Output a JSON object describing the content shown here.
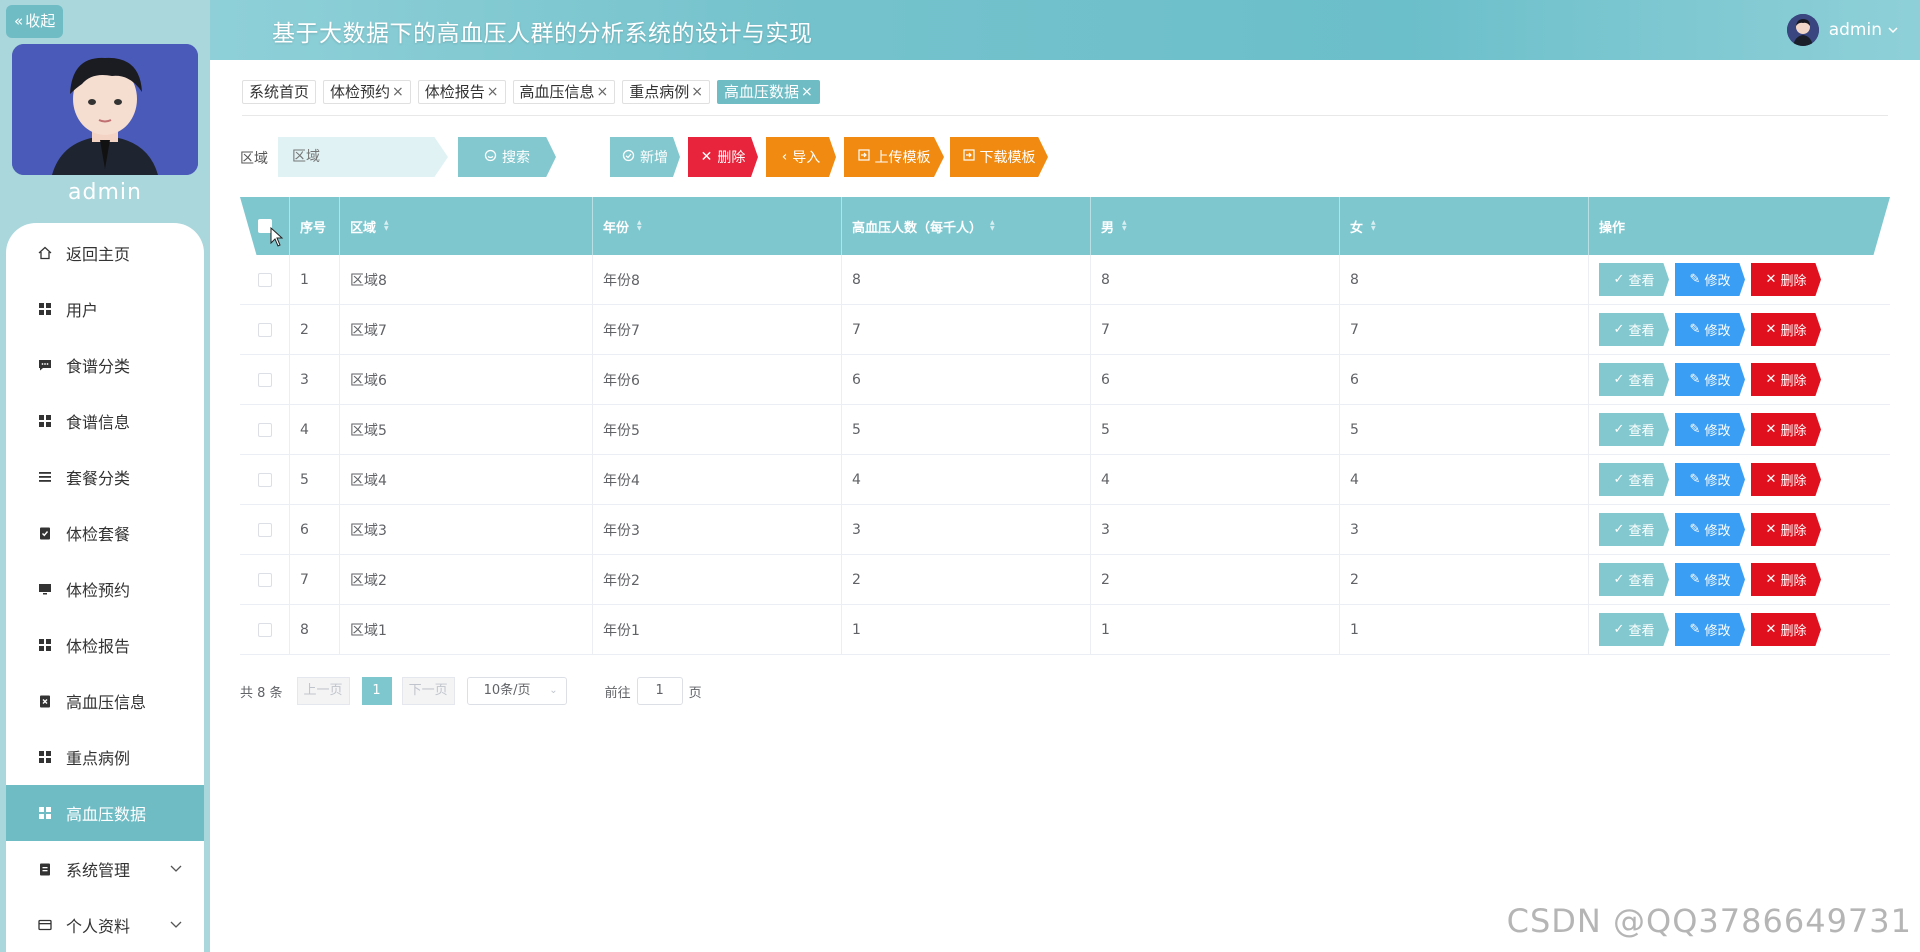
{
  "app": {
    "title": "基于大数据下的高血压人群的分析系统的设计与实现",
    "user": "admin"
  },
  "sidebar": {
    "collapse_label": "收起",
    "username": "admin",
    "items": [
      {
        "label": "返回主页",
        "icon": "home-icon"
      },
      {
        "label": "用户",
        "icon": "grid-icon"
      },
      {
        "label": "食谱分类",
        "icon": "message-icon"
      },
      {
        "label": "食谱信息",
        "icon": "grid-icon"
      },
      {
        "label": "套餐分类",
        "icon": "list-icon"
      },
      {
        "label": "体检套餐",
        "icon": "clipboard-check-icon"
      },
      {
        "label": "体检预约",
        "icon": "monitor-icon"
      },
      {
        "label": "体检报告",
        "icon": "grid-icon"
      },
      {
        "label": "高血压信息",
        "icon": "clipboard-x-icon"
      },
      {
        "label": "重点病例",
        "icon": "grid-icon"
      },
      {
        "label": "高血压数据",
        "icon": "grid-icon"
      },
      {
        "label": "系统管理",
        "icon": "clipboard-icon"
      },
      {
        "label": "个人资料",
        "icon": "card-icon"
      }
    ]
  },
  "tabs": [
    {
      "label": "系统首页",
      "closable": false
    },
    {
      "label": "体检预约",
      "closable": true
    },
    {
      "label": "体检报告",
      "closable": true
    },
    {
      "label": "高血压信息",
      "closable": true
    },
    {
      "label": "重点病例",
      "closable": true
    },
    {
      "label": "高血压数据",
      "closable": true
    }
  ],
  "search": {
    "label": "区域",
    "placeholder": "区域",
    "search_btn": "搜索"
  },
  "toolbar": {
    "add": "新增",
    "delete": "删除",
    "import": "导入",
    "upload_template": "上传模板",
    "download_template": "下载模板"
  },
  "table": {
    "headers": [
      "序号",
      "区域",
      "年份",
      "高血压人数（每千人）",
      "男",
      "女",
      "操作"
    ],
    "rows": [
      {
        "no": "1",
        "region": "区域8",
        "year": "年份8",
        "count": "8",
        "male": "8",
        "female": "8"
      },
      {
        "no": "2",
        "region": "区域7",
        "year": "年份7",
        "count": "7",
        "male": "7",
        "female": "7"
      },
      {
        "no": "3",
        "region": "区域6",
        "year": "年份6",
        "count": "6",
        "male": "6",
        "female": "6"
      },
      {
        "no": "4",
        "region": "区域5",
        "year": "年份5",
        "count": "5",
        "male": "5",
        "female": "5"
      },
      {
        "no": "5",
        "region": "区域4",
        "year": "年份4",
        "count": "4",
        "male": "4",
        "female": "4"
      },
      {
        "no": "6",
        "region": "区域3",
        "year": "年份3",
        "count": "3",
        "male": "3",
        "female": "3"
      },
      {
        "no": "7",
        "region": "区域2",
        "year": "年份2",
        "count": "2",
        "male": "2",
        "female": "2"
      },
      {
        "no": "8",
        "region": "区域1",
        "year": "年份1",
        "count": "1",
        "male": "1",
        "female": "1"
      }
    ],
    "ops": {
      "view": "查看",
      "edit": "修改",
      "delete": "删除"
    }
  },
  "pager": {
    "total": "共 8 条",
    "prev": "上一页",
    "current": "1",
    "next": "下一页",
    "page_size": "10条/页",
    "goto_label": "前往",
    "goto_value": "1",
    "page_unit": "页"
  },
  "watermark": "CSDN @QQ3786649731",
  "colors": {
    "accent": "#7ec7cf",
    "sidebar_bg": "#a9d7dc",
    "danger": "#e0101e",
    "primary": "#3b9ef5",
    "warning": "#f08a10"
  }
}
